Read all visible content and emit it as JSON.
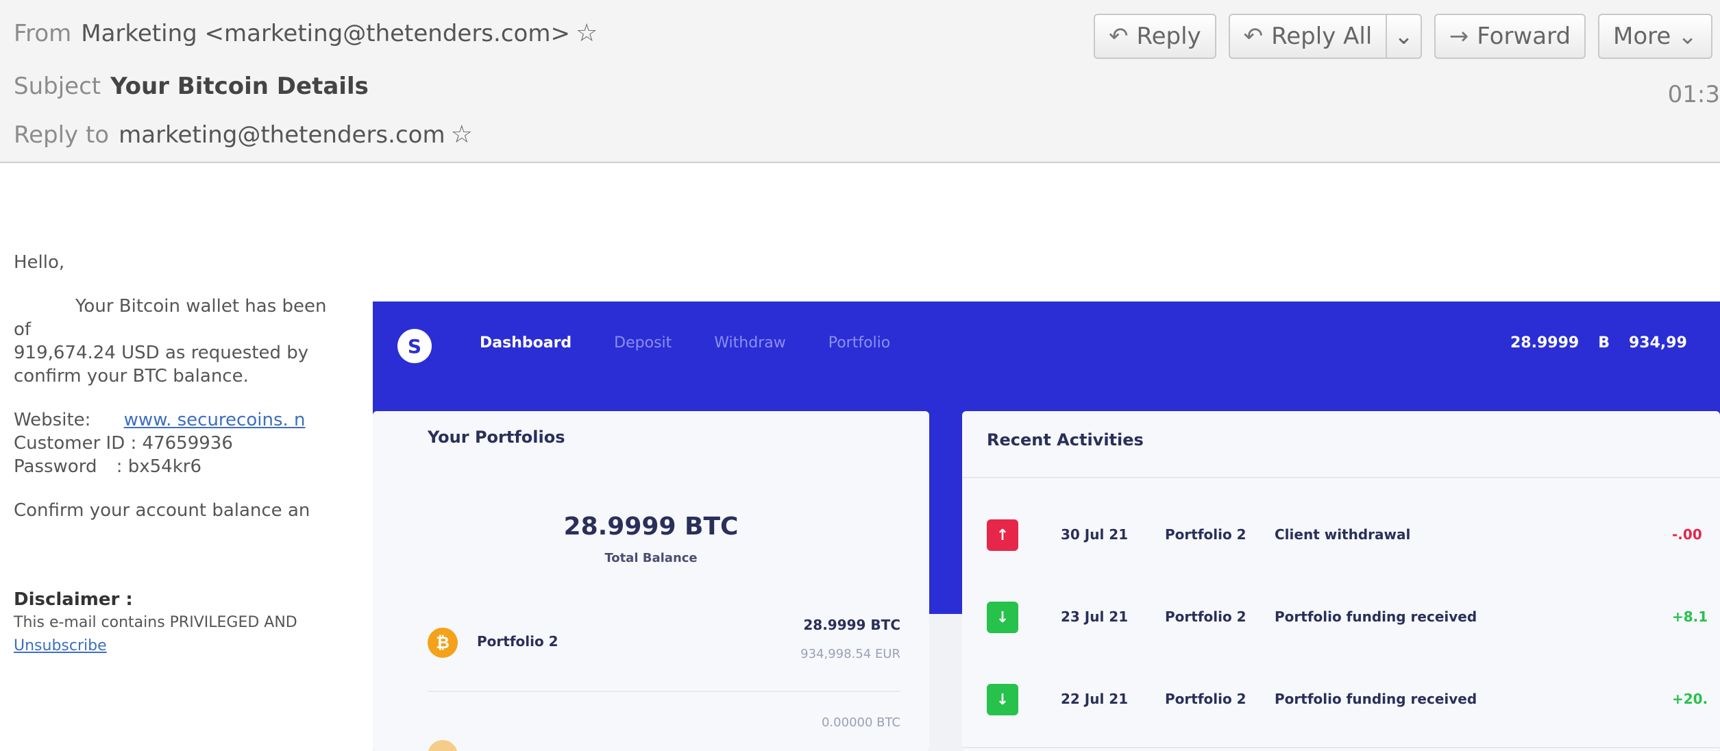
{
  "email": {
    "from_label": "From",
    "from_value": "Marketing <marketing@thetenders.com>",
    "subject_label": "Subject",
    "subject_value": "Your Bitcoin Details",
    "replyto_label": "Reply to",
    "replyto_value": "marketing@thetenders.com",
    "time": "01:3",
    "toolbar": {
      "reply": "Reply",
      "reply_all": "Reply All",
      "forward": "Forward",
      "more": "More"
    },
    "body": {
      "greeting": "Hello,",
      "line1": "Your Bitcoin wallet has been",
      "line2": "of",
      "line3": "919,674.24 USD as requested by",
      "line4": "confirm your BTC balance.",
      "website_label": "Website:",
      "website_value": "www. securecoins. n",
      "customer_id": "Customer ID : 47659936",
      "password_label": "Password",
      "password_value": ": bx54kr6",
      "confirm": "Confirm your account balance an",
      "disclaimer_head": "Disclaimer :",
      "disclaimer_text": "This e-mail contains PRIVILEGED AND",
      "unsubscribe": "Unsubscribe"
    }
  },
  "dashboard": {
    "logo": "S",
    "menu": [
      "Dashboard",
      "Deposit",
      "Withdraw",
      "Portfolio"
    ],
    "nav_btc": "28.9999",
    "nav_btc_symbol": "B",
    "nav_fiat": "934,99",
    "portfolios_title": "Your Portfolios",
    "total_balance": "28.9999 BTC",
    "total_label": "Total Balance",
    "portfolios": [
      {
        "name": "Portfolio 2",
        "btc": "28.9999 BTC",
        "fiat": "934,998.54 EUR"
      },
      {
        "name": "",
        "btc": "0.00000 BTC",
        "fiat": ""
      }
    ],
    "activities_title": "Recent Activities",
    "activities": [
      {
        "date": "30 Jul 21",
        "portfolio": "Portfolio 2",
        "desc": "Client withdrawal",
        "amount": "-.00",
        "type": "out"
      },
      {
        "date": "23 Jul 21",
        "portfolio": "Portfolio 2",
        "desc": "Portfolio funding received",
        "amount": "+8.1",
        "type": "in"
      },
      {
        "date": "22 Jul 21",
        "portfolio": "Portfolio 2",
        "desc": "Portfolio funding received",
        "amount": "+20.",
        "type": "in"
      }
    ],
    "colors": {
      "primary": "#2b2ed4",
      "negative": "#e6274a",
      "positive": "#27c24c",
      "coin": "#f4a21a"
    }
  }
}
